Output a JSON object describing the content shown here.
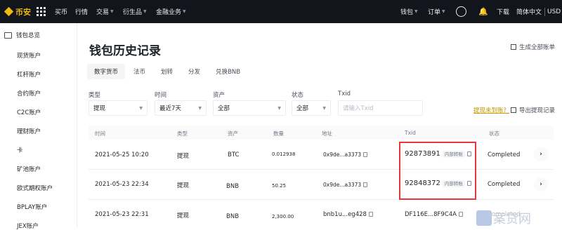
{
  "topbar": {
    "brand": "币安",
    "nav": [
      "买币",
      "行情",
      "交易",
      "衍生品",
      "金融业务"
    ],
    "right_wallet": "钱包",
    "right_orders": "订单",
    "download": "下载",
    "lang": "简体中文",
    "currency": "USD"
  },
  "sidebar": {
    "items": [
      "钱包总览",
      "现货账户",
      "杠杆账户",
      "合约账户",
      "C2C账户",
      "理财账户",
      "卡",
      "矿池账户",
      "欧式期权账户",
      "BPLAY账户",
      "JEX账户"
    ]
  },
  "main": {
    "title": "钱包历史记录",
    "generate_statement": "生成全部账单",
    "tabs": [
      "数字货币",
      "法币",
      "划转",
      "分发",
      "兑换BNB"
    ],
    "filters": {
      "type_label": "类型",
      "type_value": "提现",
      "time_label": "时间",
      "time_value": "最近7天",
      "asset_label": "资产",
      "asset_value": "全部",
      "status_label": "状态",
      "status_value": "全部",
      "txid_label": "Txid",
      "txid_placeholder": "请输入Txid"
    },
    "not_received": "提现未到账？",
    "export": "导出提现记录",
    "table": {
      "headers": [
        "时间",
        "类型",
        "资产",
        "数量",
        "地址",
        "Txid",
        "状态"
      ],
      "rows": [
        {
          "time": "2021-05-25 10:20",
          "type": "提现",
          "asset": "BTC",
          "amount": "0.012938",
          "address": "0x9de...a3373",
          "txid": "92873891",
          "badge": "内部转账",
          "status": "Completed"
        },
        {
          "time": "2021-05-23 22:34",
          "type": "提现",
          "asset": "BNB",
          "amount": "50.25",
          "address": "0x9de...a3373",
          "txid": "92848372",
          "badge": "内部转账",
          "status": "Completed"
        },
        {
          "time": "2021-05-23 22:31",
          "type": "提现",
          "asset": "BNB",
          "amount": "2,300.00",
          "address": "bnb1u...eg428",
          "txid": "DF116E...8F9C4A",
          "badge": "",
          "status": "Completed"
        }
      ]
    }
  },
  "watermark": "案贷网"
}
